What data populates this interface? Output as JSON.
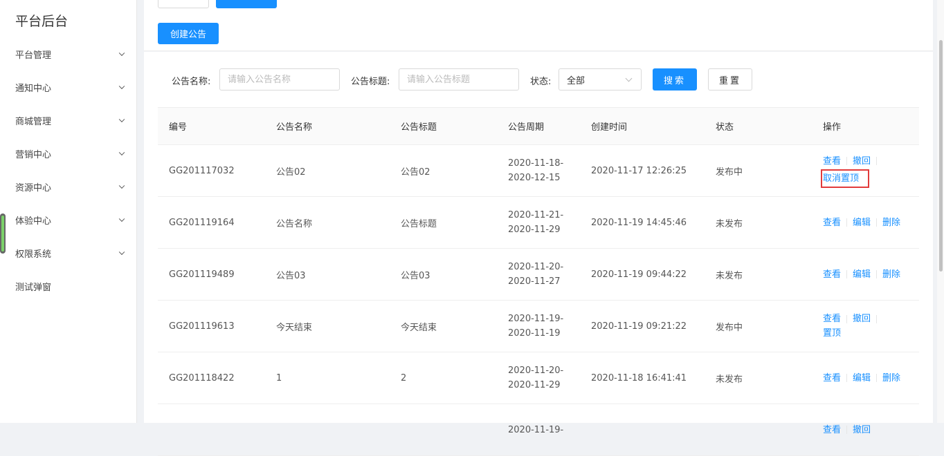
{
  "sidebar": {
    "title": "平台后台",
    "items": [
      {
        "label": "平台管理",
        "expandable": true
      },
      {
        "label": "通知中心",
        "expandable": true
      },
      {
        "label": "商城管理",
        "expandable": true
      },
      {
        "label": "营销中心",
        "expandable": true
      },
      {
        "label": "资源中心",
        "expandable": true
      },
      {
        "label": "体验中心",
        "expandable": true
      },
      {
        "label": "权限系统",
        "expandable": true
      },
      {
        "label": "测试弹窗",
        "expandable": false
      }
    ]
  },
  "toolbar": {
    "create_label": "创建公告"
  },
  "filters": {
    "name_label": "公告名称:",
    "name_placeholder": "请输入公告名称",
    "title_label": "公告标题:",
    "title_placeholder": "请输入公告标题",
    "status_label": "状态:",
    "status_value": "全部",
    "search_label": "搜索",
    "reset_label": "重置"
  },
  "table": {
    "headers": [
      "编号",
      "公告名称",
      "公告标题",
      "公告周期",
      "创建时间",
      "状态",
      "操作"
    ],
    "rows": [
      {
        "id": "GG201117032",
        "name": "公告02",
        "title": "公告02",
        "start": "2020-11-18-",
        "end": "2020-12-15",
        "created": "2020-11-17 12:26:25",
        "status": "发布中",
        "ops_line1": [
          "查看",
          "撤回"
        ],
        "ops_line2": "取消置顶"
      },
      {
        "id": "GG201119164",
        "name": "公告名称",
        "title": "公告标题",
        "start": "2020-11-21-",
        "end": "2020-11-29",
        "created": "2020-11-19 14:45:46",
        "status": "未发布",
        "ops_line1": [
          "查看",
          "编辑",
          "删除"
        ],
        "ops_line2": ""
      },
      {
        "id": "GG201119489",
        "name": "公告03",
        "title": "公告03",
        "start": "2020-11-20-",
        "end": "2020-11-27",
        "created": "2020-11-19 09:44:22",
        "status": "未发布",
        "ops_line1": [
          "查看",
          "编辑",
          "删除"
        ],
        "ops_line2": ""
      },
      {
        "id": "GG201119613",
        "name": "今天结束",
        "title": "今天结束",
        "start": "2020-11-19-",
        "end": "2020-11-19",
        "created": "2020-11-19 09:21:22",
        "status": "发布中",
        "ops_line1": [
          "查看",
          "撤回"
        ],
        "ops_line2": "置顶"
      },
      {
        "id": "GG201118422",
        "name": "1",
        "title": "2",
        "start": "2020-11-20-",
        "end": "2020-11-29",
        "created": "2020-11-18 16:41:41",
        "status": "未发布",
        "ops_line1": [
          "查看",
          "编辑",
          "删除"
        ],
        "ops_line2": ""
      },
      {
        "id": "",
        "name": "",
        "title": "",
        "start": "2020-11-19-",
        "end": "",
        "created": "",
        "status": "",
        "ops_line1": [
          "查看",
          "撤回"
        ],
        "ops_line2": ""
      }
    ]
  },
  "colors": {
    "primary": "#1890ff",
    "highlight_border": "#e23a3a"
  }
}
